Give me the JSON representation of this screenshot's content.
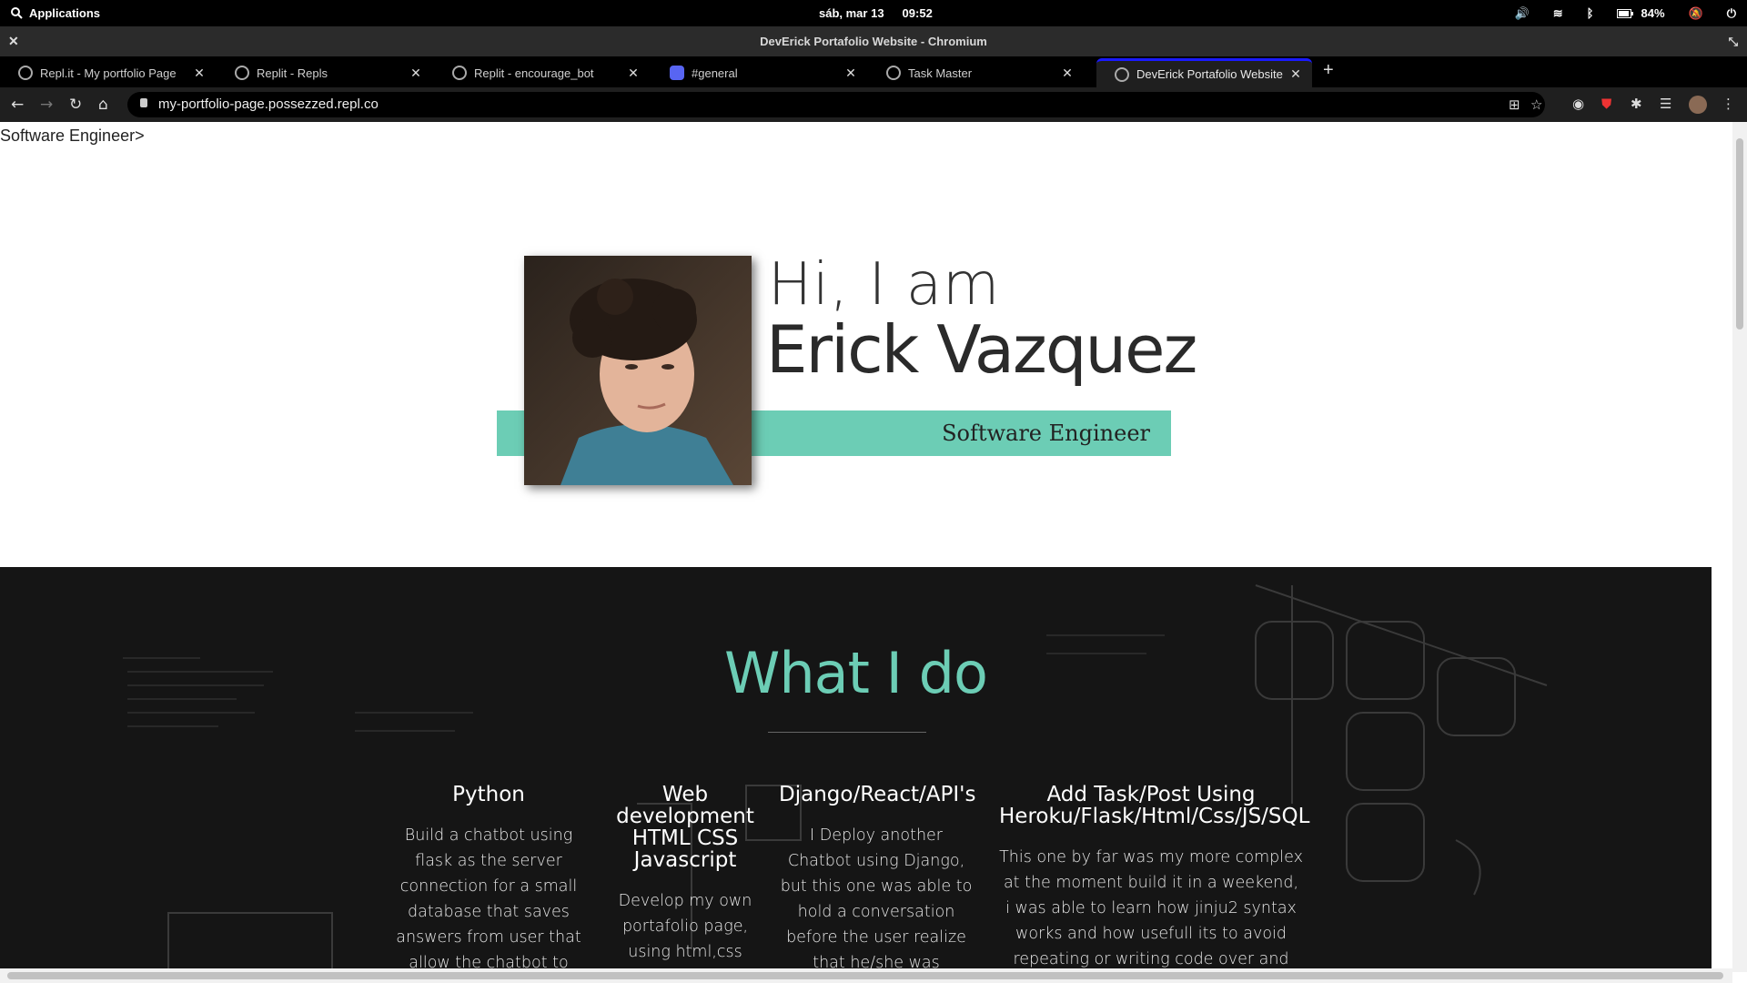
{
  "system": {
    "apps_label": "Applications",
    "date": "sáb, mar 13",
    "time": "09:52",
    "battery": "84%"
  },
  "window": {
    "title": "DevErick Portafolio Website - Chromium"
  },
  "tabs": [
    {
      "label": "Repl.it - My portfolio Page"
    },
    {
      "label": "Replit - Repls"
    },
    {
      "label": "Replit - encourage_bot"
    },
    {
      "label": "#general"
    },
    {
      "label": "Task Master"
    },
    {
      "label": "DevErick Portafolio Website"
    }
  ],
  "toolbar": {
    "url": "my-portfolio-page.possezzed.repl.co"
  },
  "page": {
    "glitch_text": "Software Engineer>",
    "hero": {
      "greeting": "Hi, I am",
      "name": "Erick Vazquez",
      "role": "Software Engineer"
    },
    "section": {
      "title": "What I do",
      "items": [
        {
          "title": "Python",
          "body": "Build a chatbot using flask as the server connection for a small database that saves answers from user that allow the chatbot to respond in a better and"
        },
        {
          "title": "Web development HTML CSS Javascript",
          "body": "Develop my own portafolio page, using html,css"
        },
        {
          "title": "Django/React/API's",
          "body": "I Deploy another Chatbot using Django, but this one was able to hold a conversation before the user realize that he/she was speaking with a bot"
        },
        {
          "title": "Add Task/Post Using Heroku/Flask/Html/Css/JS/SQL",
          "body": "This one by far was my more complex at the moment build it in a weekend, i was able to learn how jinju2 syntax works and how usefull its to avoid repeating or writing code over and over, also was"
        }
      ]
    }
  },
  "colors": {
    "accent": "#6ccdb5",
    "dark_section": "#151515",
    "active_tab_indicator": "#1a1aff"
  }
}
